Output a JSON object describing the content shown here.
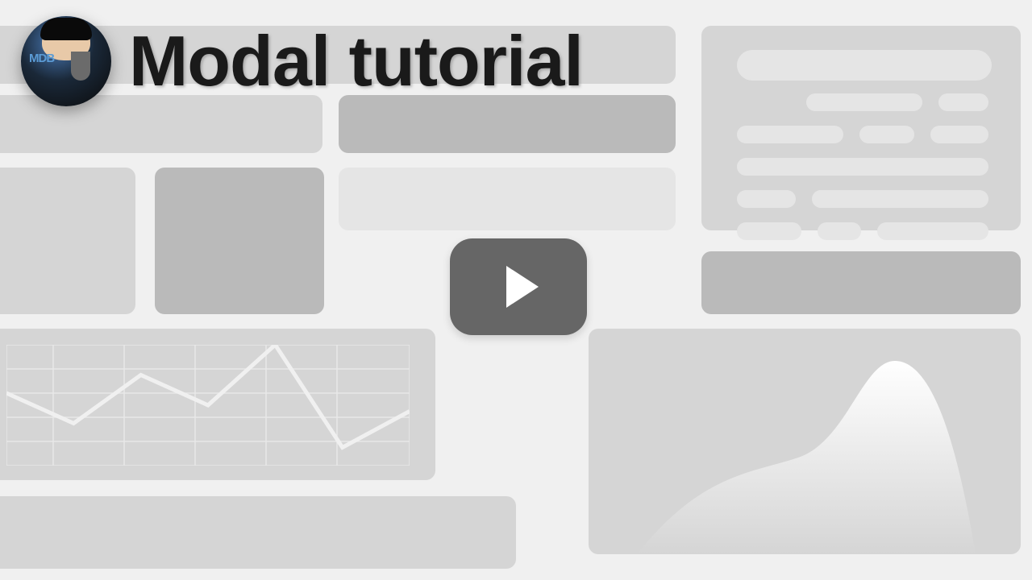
{
  "header": {
    "title": "Modal tutorial",
    "avatar_badge": "MDB"
  },
  "play_button": {
    "label": "Play video"
  },
  "chart_data": {
    "type": "line",
    "title": "",
    "xlabel": "",
    "ylabel": "",
    "x": [
      0,
      1,
      2,
      3,
      4,
      5,
      6
    ],
    "values": [
      60,
      35,
      75,
      50,
      100,
      15,
      45
    ],
    "ylim": [
      0,
      100
    ]
  }
}
